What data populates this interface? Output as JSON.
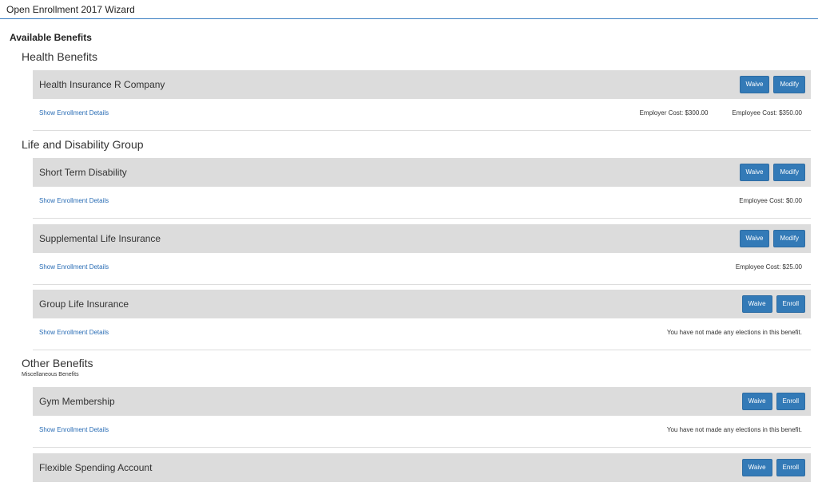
{
  "header": {
    "title": "Open Enrollment 2017 Wizard"
  },
  "available_heading": "Available Benefits",
  "groups": {
    "health": {
      "label": "Health Benefits"
    },
    "life": {
      "label": "Life and Disability Group"
    },
    "other": {
      "label": "Other Benefits",
      "sublabel": "Miscellaneous Benefits"
    }
  },
  "benefits": [
    {
      "name": "Health Insurance R Company",
      "buttons": [
        "Waive",
        "Modify"
      ],
      "details_link": "Show Enrollment Details",
      "info": [
        "Employer Cost: $300.00",
        "Employee Cost: $350.00"
      ]
    },
    {
      "name": "Short Term Disability",
      "buttons": [
        "Waive",
        "Modify"
      ],
      "details_link": "Show Enrollment Details",
      "info": [
        "Employee Cost: $0.00"
      ]
    },
    {
      "name": "Supplemental Life Insurance",
      "buttons": [
        "Waive",
        "Modify"
      ],
      "details_link": "Show Enrollment Details",
      "info": [
        "Employee Cost: $25.00"
      ]
    },
    {
      "name": "Group Life Insurance",
      "buttons": [
        "Waive",
        "Enroll"
      ],
      "details_link": "Show Enrollment Details",
      "info": [
        "You have not made any elections in this benefit."
      ]
    },
    {
      "name": "Gym Membership",
      "buttons": [
        "Waive",
        "Enroll"
      ],
      "details_link": "Show Enrollment Details",
      "info": [
        "You have not made any elections in this benefit."
      ]
    },
    {
      "name": "Flexible Spending Account",
      "buttons": [
        "Waive",
        "Enroll"
      ]
    }
  ],
  "colors": {
    "button": "#337ab7",
    "bar": "#dcdcdc",
    "link": "#2a6db5",
    "header_rule": "#3a7dc2"
  }
}
